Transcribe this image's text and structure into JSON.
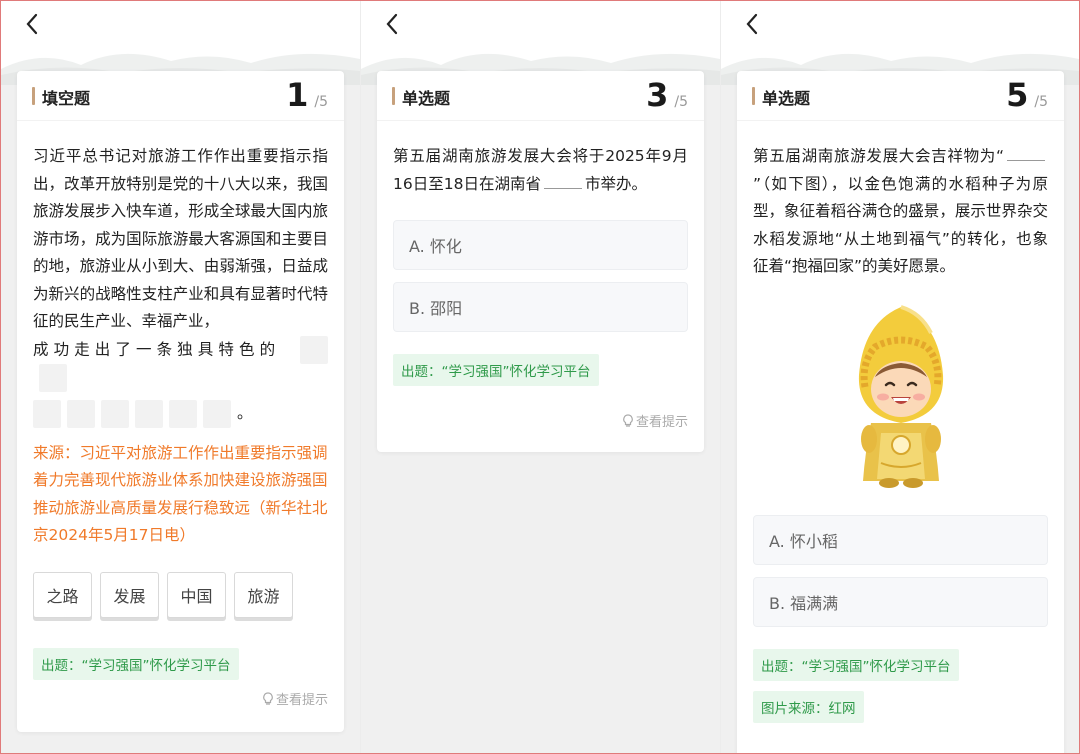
{
  "panels": [
    {
      "type_label": "填空题",
      "current": "1",
      "total": "/5",
      "question_text": "习近平总书记对旅游工作作出重要指示指出，改革开放特别是党的十八大以来，我国旅游发展步入快车道，形成全球最大国内旅游市场，成为国际旅游最大客源国和主要目的地，旅游业从小到大、由弱渐强，日益成为新兴的战略性支柱产业和具有显著时代特征的民生产业、幸福产业，",
      "question_tail": "成功走出了一条独具特色的",
      "end_punct": "。",
      "source": "来源：习近平对旅游工作作出重要指示强调 着力完善现代旅游业体系加快建设旅游强国 推动旅游业高质量发展行稳致远（新华社北京2024年5月17日电）",
      "chips": [
        "之路",
        "发展",
        "中国",
        "旅游"
      ],
      "tag": "出题：“学习强国”怀化学习平台",
      "hint": "查看提示"
    },
    {
      "type_label": "单选题",
      "current": "3",
      "total": "/5",
      "question_before": "第五届湖南旅游发展大会将于2025年9月16日至18日在湖南省",
      "question_after": "市举办。",
      "options": [
        "A. 怀化",
        "B. 邵阳"
      ],
      "tag": "出题：“学习强国”怀化学习平台",
      "hint": "查看提示"
    },
    {
      "type_label": "单选题",
      "current": "5",
      "total": "/5",
      "question_before": "第五届湖南旅游发展大会吉祥物为“",
      "question_after": "”（如下图），以金色饱满的水稻种子为原型，象征着稻谷满仓的盛景，展示世界杂交水稻发源地“从土地到福气”的转化，也象征着“抱福回家”的美好愿景。",
      "options": [
        "A. 怀小稻",
        "B. 福满满"
      ],
      "tag": "出题：“学习强国”怀化学习平台",
      "tag2": "图片来源：红网"
    }
  ],
  "colors": {
    "accent_bar": "#c7a17c",
    "source_orange": "#f07a2a",
    "tag_green": "#2f9a4a",
    "tag_bg": "#e8f7ec"
  },
  "icons": [
    "back-arrow-icon",
    "lightbulb-icon",
    "mascot-image"
  ]
}
